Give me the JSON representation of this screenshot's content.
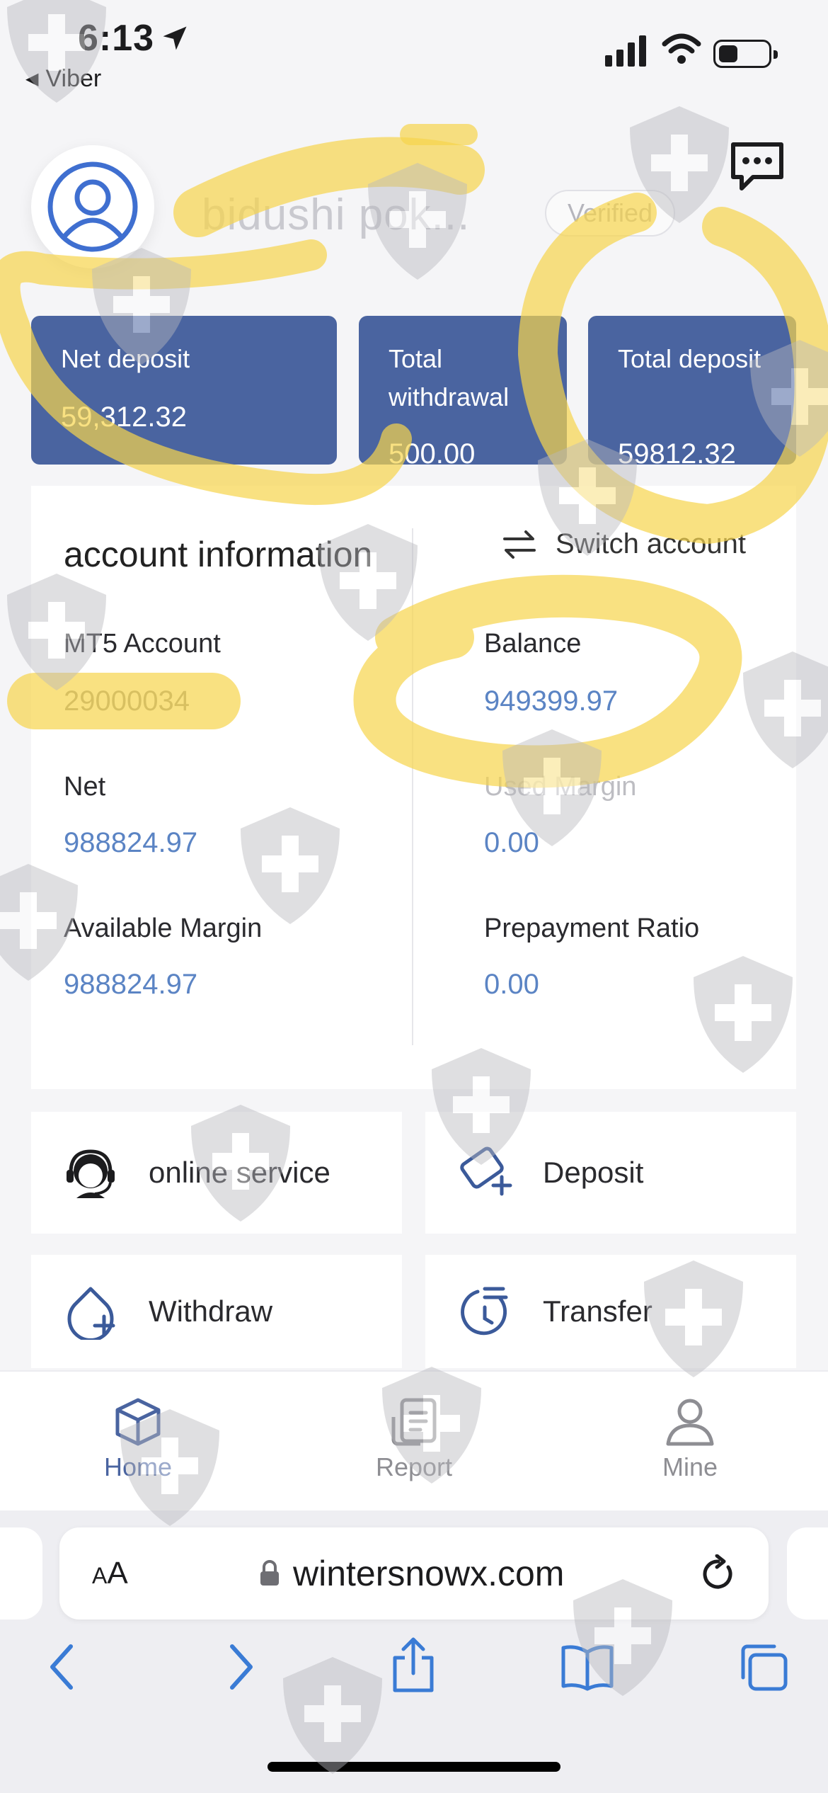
{
  "status_bar": {
    "time": "6:13",
    "back_app": "Viber"
  },
  "profile": {
    "username": "bidushi pok...",
    "verified": "Verified"
  },
  "stats": [
    {
      "label": "Net deposit",
      "value": "59,312.32"
    },
    {
      "label": "Total withdrawal",
      "value": "500.00"
    },
    {
      "label": "Total deposit",
      "value": "59812.32"
    }
  ],
  "account": {
    "title": "account information",
    "switch_label": "Switch account",
    "fields": {
      "mt5_label": "MT5 Account",
      "mt5_value": "29000034",
      "balance_label": "Balance",
      "balance_value": "949399.97",
      "net_label": "Net",
      "net_value": "988824.97",
      "used_margin_label": "Used Margin",
      "used_margin_value": "0.00",
      "avail_margin_label": "Available Margin",
      "avail_margin_value": "988824.97",
      "prepay_label": "Prepayment Ratio",
      "prepay_value": "0.00"
    }
  },
  "actions": {
    "online_service": "online service",
    "deposit": "Deposit",
    "withdraw": "Withdraw",
    "transfer": "Transfer"
  },
  "tabbar": {
    "home": "Home",
    "report": "Report",
    "mine": "Mine"
  },
  "browser": {
    "aa_small": "A",
    "aa_large": "A",
    "url": "wintersnowx.com"
  },
  "colors": {
    "accent": "#4a64a0",
    "value_blue": "#5b84c4",
    "highlighter": "#f7d44c"
  }
}
